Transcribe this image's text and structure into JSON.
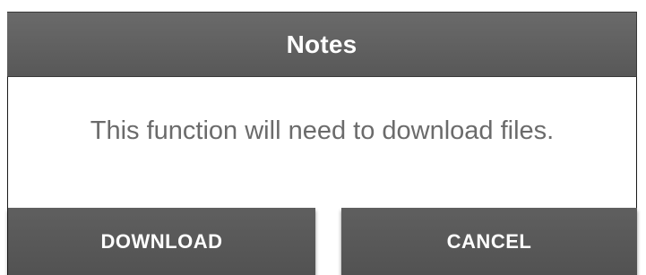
{
  "dialog": {
    "title": "Notes",
    "message": "This function will need to download files.",
    "buttons": {
      "download_label": "DOWNLOAD",
      "cancel_label": "CANCEL"
    }
  },
  "colors": {
    "title_bar": "#5f5f5f",
    "button": "#585858",
    "message_text": "#6b6b6b",
    "background": "#ffffff"
  }
}
